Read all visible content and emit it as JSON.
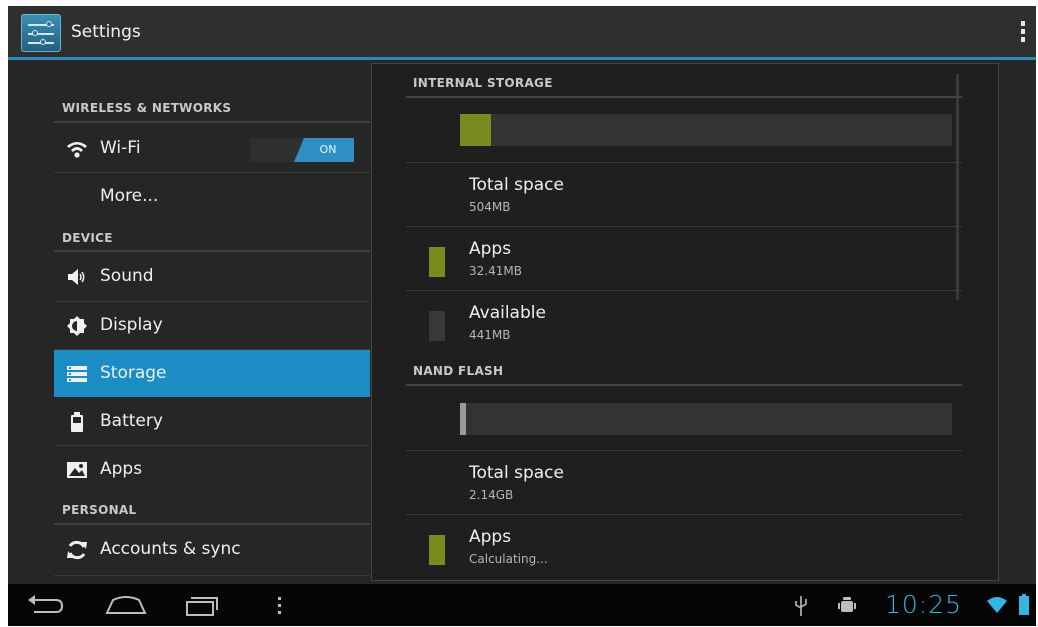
{
  "action_bar": {
    "title": "Settings",
    "icon": "settings-sliders-icon"
  },
  "sections": {
    "wireless": "WIRELESS & NETWORKS",
    "device": "DEVICE",
    "personal": "PERSONAL"
  },
  "menu": {
    "wifi": {
      "label": "Wi-Fi",
      "toggle": "ON",
      "icon": "wifi-icon"
    },
    "more": {
      "label": "More..."
    },
    "sound": {
      "label": "Sound",
      "icon": "speaker-icon"
    },
    "display": {
      "label": "Display",
      "icon": "brightness-icon"
    },
    "storage": {
      "label": "Storage",
      "icon": "storage-icon"
    },
    "battery": {
      "label": "Battery",
      "icon": "battery-icon"
    },
    "apps": {
      "label": "Apps",
      "icon": "apps-icon"
    },
    "accounts": {
      "label": "Accounts & sync",
      "icon": "sync-icon"
    }
  },
  "storage": {
    "internal": {
      "header": "INTERNAL STORAGE",
      "used_fraction": 0.064,
      "total": {
        "label": "Total space",
        "value": "504MB"
      },
      "apps": {
        "label": "Apps",
        "value": "32.41MB"
      },
      "available": {
        "label": "Available",
        "value": "441MB"
      }
    },
    "nand": {
      "header": "NAND FLASH",
      "total": {
        "label": "Total space",
        "value": "2.14GB"
      },
      "apps": {
        "label": "Apps",
        "value": "Calculating..."
      }
    }
  },
  "status_bar": {
    "time": "10:25"
  },
  "colors": {
    "accent": "#1c8cc4",
    "apps_swatch": "#7a8a1f",
    "clock": "#33b5e5"
  }
}
